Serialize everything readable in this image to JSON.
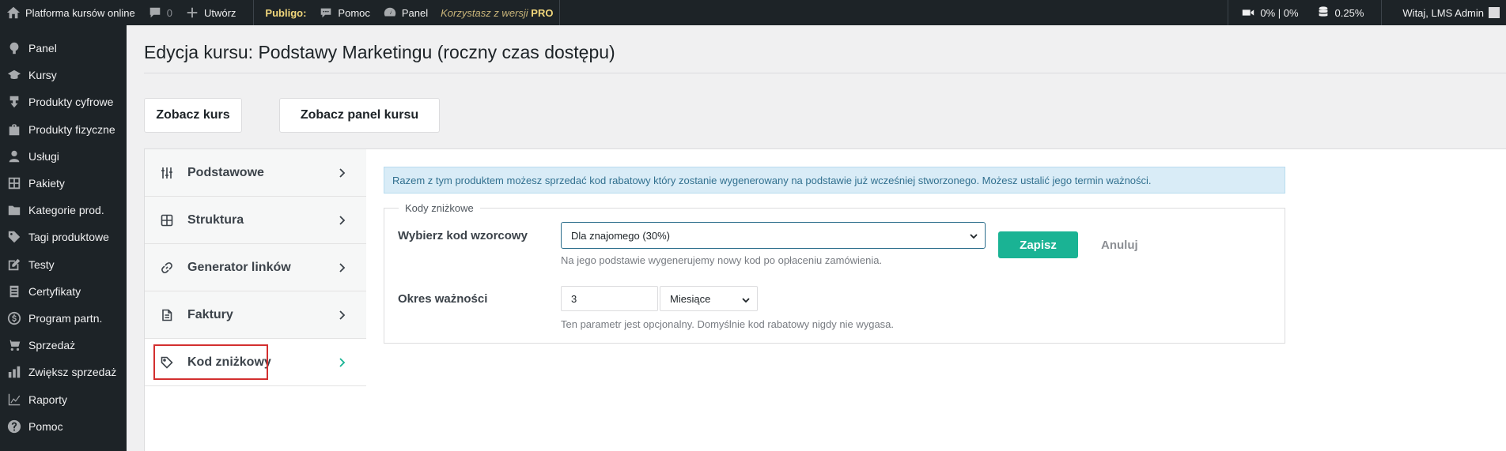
{
  "admin_bar": {
    "site_name": "Platforma kursów online",
    "comments_count": "0",
    "new_label": "Utwórz",
    "publigo_label": "Publigo:",
    "help_label": "Pomoc",
    "panel_label": "Panel",
    "version_text": "Korzystasz z wersji",
    "version_badge": "PRO",
    "video_stats": "0% | 0%",
    "db_stats": "0.25%",
    "greeting": "Witaj, LMS Admin"
  },
  "sidebar": {
    "items": [
      {
        "label": "Panel",
        "icon": "dashboard-icon"
      },
      {
        "label": "Kursy",
        "icon": "courses-icon"
      },
      {
        "label": "Produkty cyfrowe",
        "icon": "download-icon"
      },
      {
        "label": "Produkty fizyczne",
        "icon": "bag-icon"
      },
      {
        "label": "Usługi",
        "icon": "services-icon"
      },
      {
        "label": "Pakiety",
        "icon": "grid-icon"
      },
      {
        "label": "Kategorie prod.",
        "icon": "folder-icon"
      },
      {
        "label": "Tagi produktowe",
        "icon": "tag-icon"
      },
      {
        "label": "Testy",
        "icon": "edit-icon"
      },
      {
        "label": "Certyfikaty",
        "icon": "document-icon"
      },
      {
        "label": "Program partn.",
        "icon": "dollar-icon"
      },
      {
        "label": "Sprzedaż",
        "icon": "cart-icon"
      },
      {
        "label": "Zwiększ sprzedaż",
        "icon": "chart-bars-icon"
      },
      {
        "label": "Raporty",
        "icon": "chart-line-icon"
      },
      {
        "label": "Pomoc",
        "icon": "help-icon"
      }
    ]
  },
  "page": {
    "title": "Edycja kursu: Podstawy Marketingu (roczny czas dostępu)",
    "view_course_button": "Zobacz kurs",
    "view_panel_button": "Zobacz panel kursu"
  },
  "tabs": [
    {
      "label": "Podstawowe",
      "icon": "sliders-icon"
    },
    {
      "label": "Struktura",
      "icon": "structure-icon"
    },
    {
      "label": "Generator linków",
      "icon": "link-icon"
    },
    {
      "label": "Faktury",
      "icon": "invoice-icon"
    },
    {
      "label": "Kod zniżkowy",
      "icon": "tag-icon",
      "active": true
    }
  ],
  "discount": {
    "notice": "Razem z tym produktem możesz sprzedać kod rabatowy który zostanie wygenerowany na podstawie już wcześniej stworzonego. Możesz ustalić jego termin ważności.",
    "legend": "Kody zniżkowe",
    "template_label": "Wybierz kod wzorcowy",
    "template_value": "Dla znajomego (30%)",
    "template_hint": "Na jego podstawie wygenerujemy nowy kod po opłaceniu zamówienia.",
    "save_button": "Zapisz",
    "cancel_button": "Anuluj",
    "validity_label": "Okres ważności",
    "validity_value": "3",
    "validity_unit": "Miesiące",
    "validity_hint": "Ten parametr jest opcjonalny. Domyślnie kod rabatowy nigdy nie wygasa."
  },
  "colors": {
    "accent": "#1ab394",
    "highlight": "#d32f2f",
    "admin_bar": "#1d2327"
  }
}
